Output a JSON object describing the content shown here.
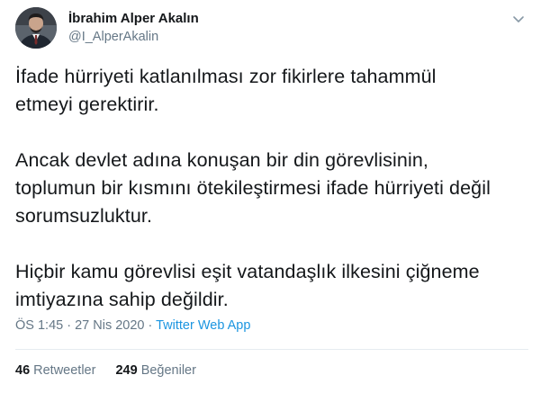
{
  "user": {
    "display_name": "İbrahim Alper Akalın",
    "handle": "@I_AlperAkalin",
    "avatar_icon": "profile-photo"
  },
  "tweet": {
    "paragraphs": [
      "İfade hürriyeti katlanılması zor fikirlere tahammül\netmeyi gerektirir.",
      "Ancak devlet adına konuşan bir din görevlisinin,\ntoplumun bir kısmını ötekileştirmesi ifade hürriyeti değil\nsorumsuzluktur.",
      "Hiçbir kamu görevlisi eşit vatandaşlık ilkesini çiğneme\nimtiyazına sahip değildir."
    ],
    "time": "ÖS 1:45",
    "separator": " · ",
    "date": "27 Nis 2020",
    "source": "Twitter Web App"
  },
  "stats": {
    "retweets_count": "46",
    "retweets_label": "Retweetler",
    "likes_count": "249",
    "likes_label": "Beğeniler"
  },
  "colors": {
    "text": "#14171a",
    "muted": "#657786",
    "link": "#1b95e0",
    "divider": "#e6ecf0"
  }
}
